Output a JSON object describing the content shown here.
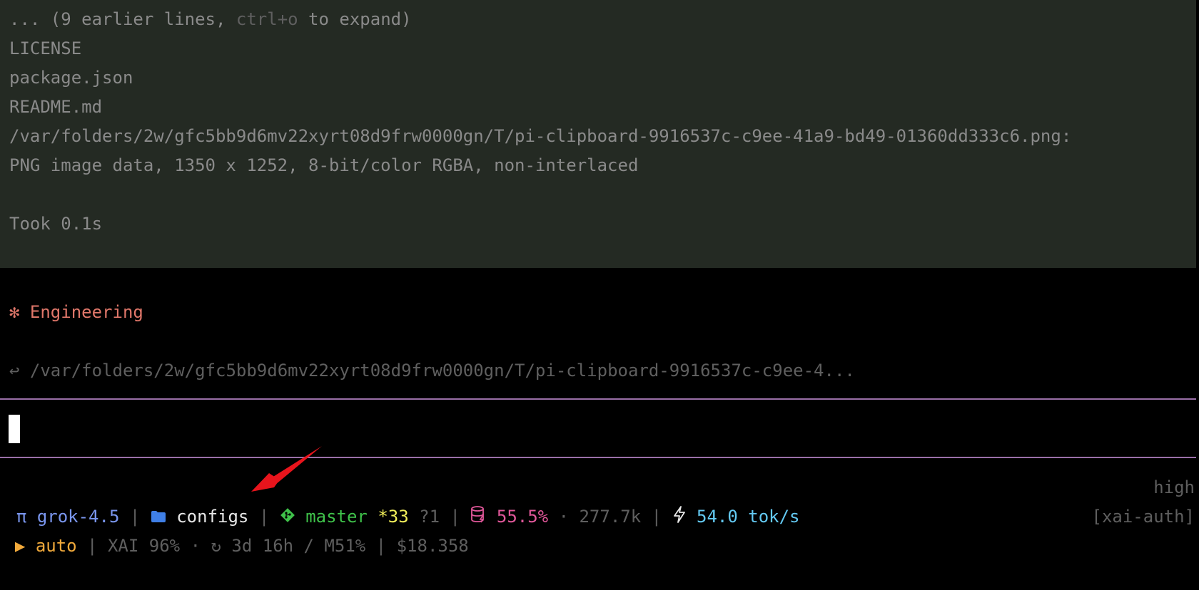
{
  "output": {
    "collapsed_prefix": "... (9 earlier lines, ",
    "collapsed_shortcut": "ctrl+o",
    "collapsed_suffix": " to expand)",
    "lines": [
      "LICENSE",
      "package.json",
      "README.md",
      "/var/folders/2w/gfc5bb9d6mv22xyrt08d9frw0000gn/T/pi-clipboard-9916537c-c9ee-41a9-bd49-01360dd333c6.png:",
      "PNG image data, 1350 x 1252, 8-bit/color RGBA, non-interlaced"
    ],
    "timing": "Took 0.1s"
  },
  "section": {
    "bullet": "✻",
    "title": "Engineering"
  },
  "attachment": {
    "glyph": "↩",
    "path": "/var/folders/2w/gfc5bb9d6mv22xyrt08d9frw0000gn/T/pi-clipboard-9916537c-c9ee-4..."
  },
  "status": {
    "pi_glyph": "π",
    "model": "grok-4.5",
    "sep": " | ",
    "folder": "configs",
    "branch": "master",
    "changes": "*33",
    "untracked": "?1",
    "context_pct": "55.5%",
    "dot": " · ",
    "tokens": "277.7k",
    "speed": "54.0 tok/s",
    "thinking": "high",
    "mode_glyph": "▶",
    "mode": "auto",
    "usage": "XAI 96%",
    "reset_glyph": "↻",
    "reset": "3d 16h / M51%",
    "cost": "$18.358",
    "auth": "[xai-auth]"
  },
  "colors": {
    "output_bg": "#242a23",
    "rule": "#9a6fa8",
    "arrow": "#e8141c"
  }
}
